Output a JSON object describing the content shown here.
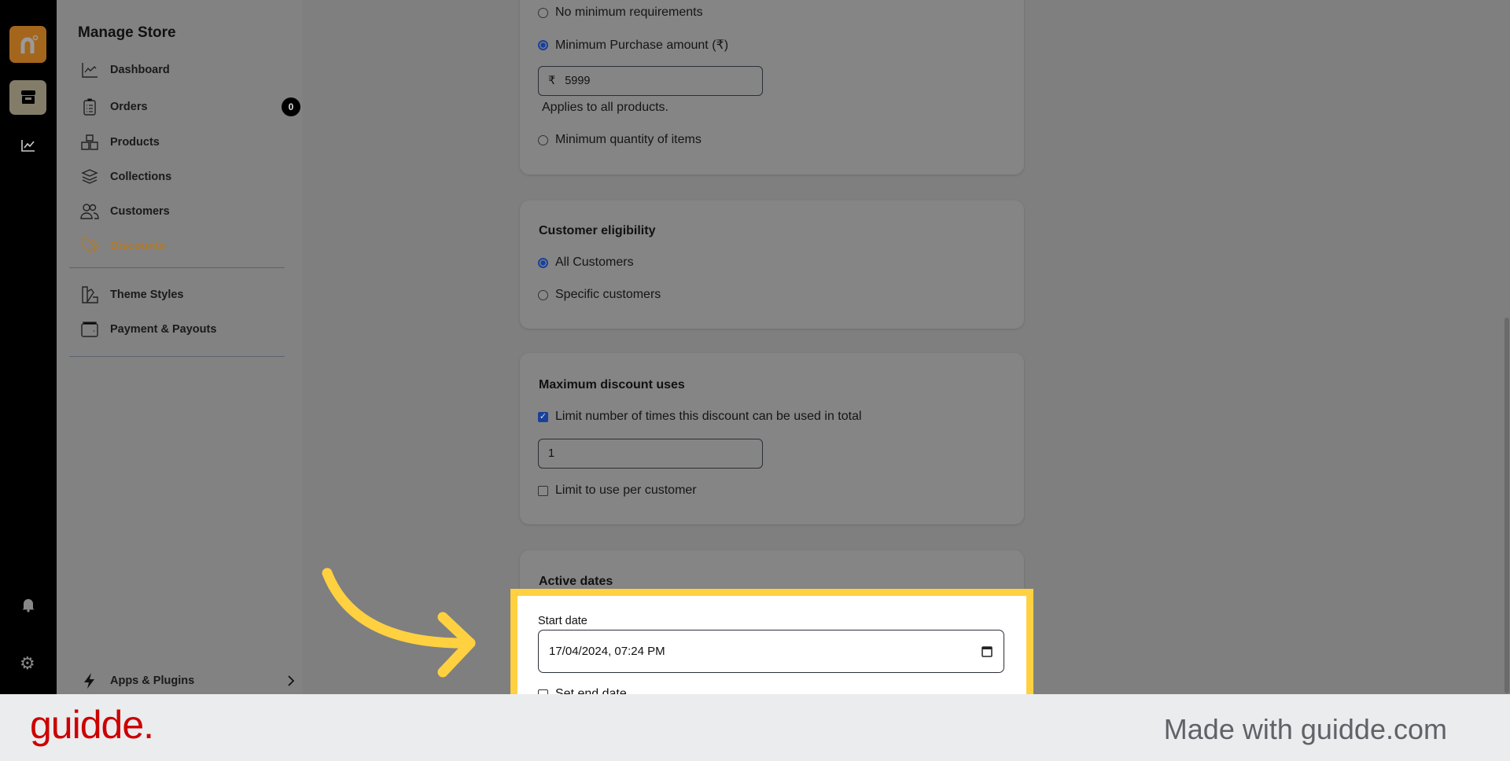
{
  "rail": {
    "icons": [
      "brand-logo",
      "store-icon",
      "analytics-icon",
      "bell-icon",
      "gear-icon"
    ]
  },
  "sidebar": {
    "title": "Manage Store",
    "items": [
      {
        "label": "Dashboard",
        "icon": "chart-line-icon"
      },
      {
        "label": "Orders",
        "icon": "clipboard-icon",
        "badge": "0"
      },
      {
        "label": "Products",
        "icon": "boxes-icon"
      },
      {
        "label": "Collections",
        "icon": "layers-icon"
      },
      {
        "label": "Customers",
        "icon": "users-icon"
      },
      {
        "label": "Discounts",
        "icon": "tag-icon",
        "active": true
      }
    ],
    "items2": [
      {
        "label": "Theme Styles",
        "icon": "swatch-icon"
      },
      {
        "label": "Payment & Payouts",
        "icon": "wallet-icon"
      }
    ],
    "apps": "Apps & Plugins",
    "active_color": "#b07a2a"
  },
  "requirements": {
    "no_min": "No minimum requirements",
    "min_purchase": "Minimum Purchase amount (₹)",
    "currency": "₹",
    "amount": "5999",
    "applies": "Applies to all products.",
    "min_qty": "Minimum quantity of items"
  },
  "eligibility": {
    "title": "Customer eligibility",
    "all": "All Customers",
    "specific": "Specific customers"
  },
  "max_uses": {
    "title": "Maximum discount uses",
    "limit_total": "Limit number of times this discount can be used in total",
    "limit_value": "1",
    "per_customer": "Limit to use per customer"
  },
  "active_dates": {
    "title": "Active dates",
    "start_label": "Start date",
    "start_value": "17/04/2024, 07:24 PM",
    "end_label": "Set end date"
  },
  "footer": {
    "logo": "guidde.",
    "tagline": "Made with guidde.com",
    "logo_color": "#cc0000"
  },
  "highlight_color": "#ffd140"
}
